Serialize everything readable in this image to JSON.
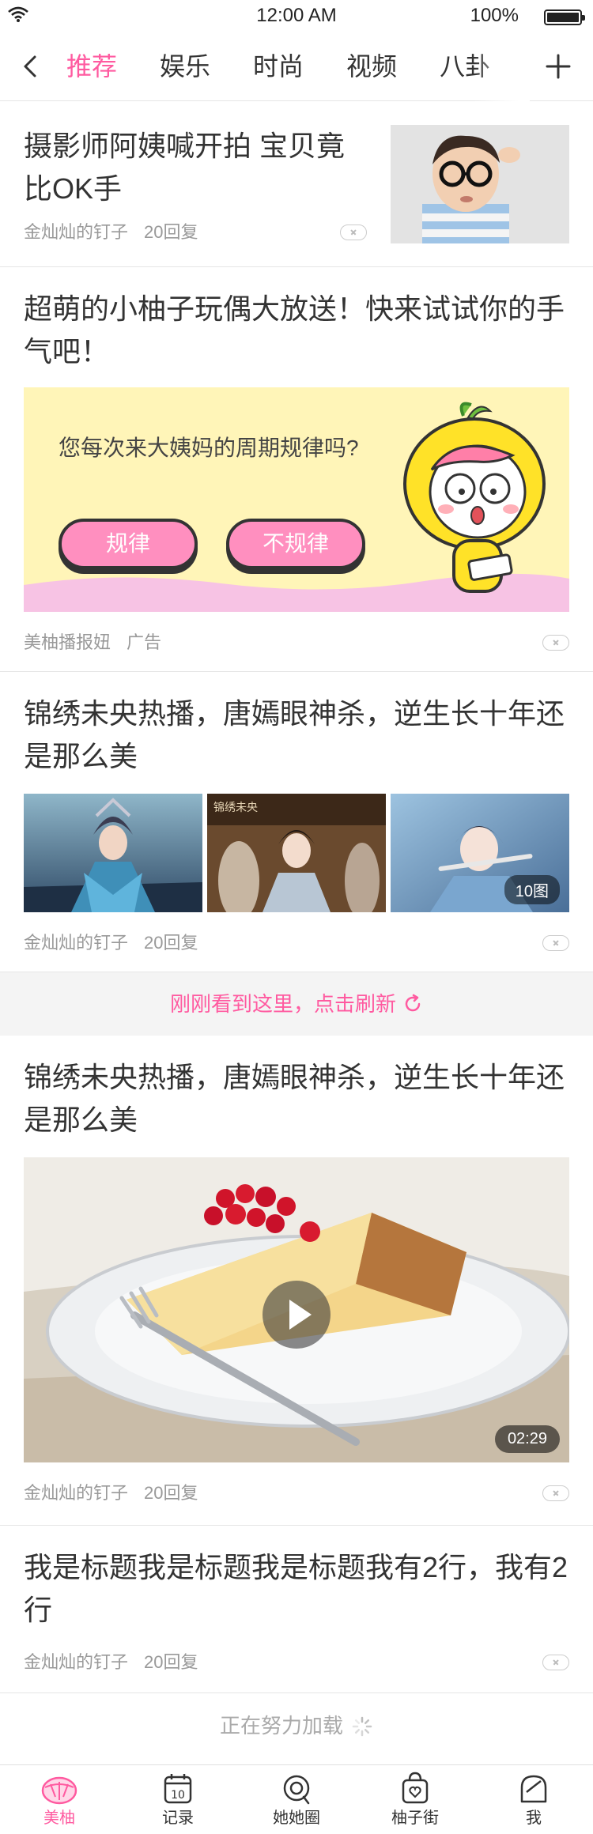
{
  "status_bar": {
    "time": "12:00 AM",
    "battery": "100%",
    "battery_level": 1.0
  },
  "top_nav": {
    "tabs": [
      "推荐",
      "娱乐",
      "时尚",
      "视频",
      "八卦"
    ],
    "active_tab": "推荐",
    "accent_color": "#ff5aa0"
  },
  "feed": {
    "article1": {
      "title": "摄影师阿姨喊开拍 宝贝竟比OK手",
      "author": "金灿灿的钉子",
      "replies": "20回复"
    },
    "ad": {
      "title": "超萌的小柚子玩偶大放送！快来试试你的手气吧！",
      "question": "您每次来大姨妈的周期规律吗?",
      "option_regular": "规律",
      "option_irregular": "不规律",
      "source": "美柚播报妞",
      "label": "广告"
    },
    "article3": {
      "title": "锦绣未央热播，唐嫣眼神杀，逆生长十年还是那么美",
      "author": "金灿灿的钉子",
      "replies": "20回复",
      "image_count": "10图"
    },
    "refresh_hint": "刚刚看到这里，点击刷新",
    "article4": {
      "title": "锦绣未央热播，唐嫣眼神杀，逆生长十年还是那么美",
      "author": "金灿灿的钉子",
      "replies": "20回复",
      "duration": "02:29"
    },
    "article5": {
      "title": "我是标题我是标题我是标题我有2行，我有2行",
      "author": "金灿灿的钉子",
      "replies": "20回复"
    },
    "loading_text": "正在努力加载"
  },
  "bottom_nav": {
    "items": [
      {
        "label": "美柚",
        "icon": "meiyou-icon"
      },
      {
        "label": "记录",
        "icon": "calendar-icon"
      },
      {
        "label": "她她圈",
        "icon": "community-icon"
      },
      {
        "label": "柚子街",
        "icon": "shop-bag-icon"
      },
      {
        "label": "我",
        "icon": "profile-icon"
      }
    ],
    "active": "美柚"
  }
}
